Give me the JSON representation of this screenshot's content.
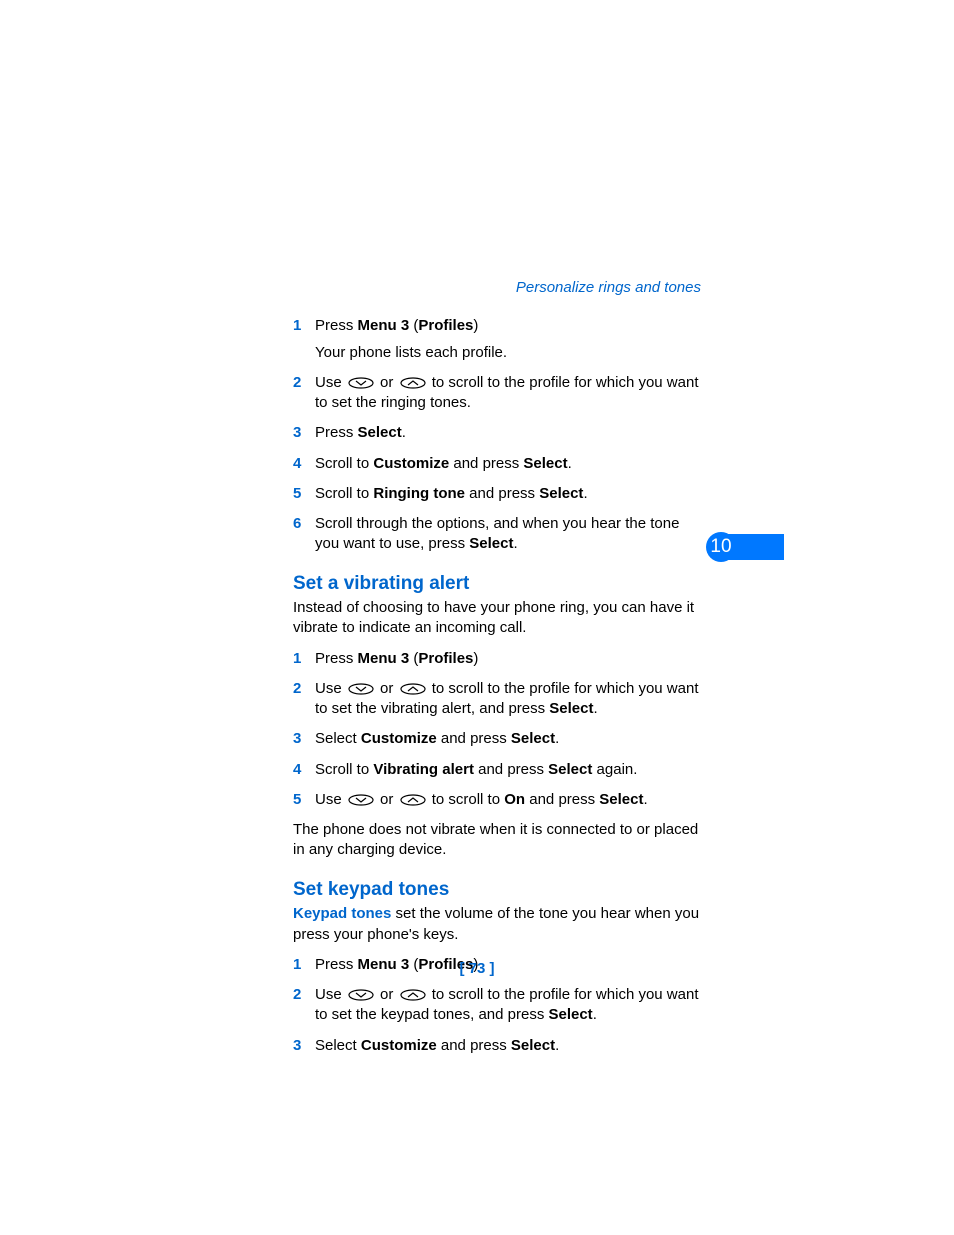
{
  "header": "Personalize rings and tones",
  "chapter_number": "10",
  "page_number": "[ 73 ]",
  "section_a": {
    "steps": [
      {
        "n": "1",
        "parts": [
          "Press ",
          {
            "b": "Menu 3"
          },
          " (",
          {
            "b": "Profiles"
          },
          ")"
        ],
        "after": "Your phone lists each profile."
      },
      {
        "n": "2",
        "parts": [
          "Use ",
          {
            "icon": "down"
          },
          " or ",
          {
            "icon": "up"
          },
          " to scroll to the profile for which you want to set the ringing tones."
        ]
      },
      {
        "n": "3",
        "parts": [
          "Press ",
          {
            "b": "Select"
          },
          "."
        ]
      },
      {
        "n": "4",
        "parts": [
          "Scroll to ",
          {
            "b": "Customize"
          },
          " and press ",
          {
            "b": "Select"
          },
          "."
        ]
      },
      {
        "n": "5",
        "parts": [
          "Scroll to ",
          {
            "b": "Ringing tone"
          },
          " and press ",
          {
            "b": "Select"
          },
          "."
        ]
      },
      {
        "n": "6",
        "parts": [
          "Scroll through the options, and when you hear the tone you want to use, press ",
          {
            "b": "Select"
          },
          "."
        ]
      }
    ]
  },
  "section_b": {
    "title": "Set a vibrating alert",
    "intro": "Instead of choosing to have your phone ring, you can have it vibrate to indicate an incoming call.",
    "steps": [
      {
        "n": "1",
        "parts": [
          "Press ",
          {
            "b": "Menu 3"
          },
          " (",
          {
            "b": "Profiles"
          },
          ")"
        ]
      },
      {
        "n": "2",
        "parts": [
          "Use ",
          {
            "icon": "down"
          },
          " or ",
          {
            "icon": "up"
          },
          " to scroll to the profile for which you want to set the vibrating alert, and press ",
          {
            "b": "Select"
          },
          "."
        ]
      },
      {
        "n": "3",
        "parts": [
          "Select ",
          {
            "b": "Customize"
          },
          " and press ",
          {
            "b": "Select"
          },
          "."
        ]
      },
      {
        "n": "4",
        "parts": [
          "Scroll to ",
          {
            "b": "Vibrating alert"
          },
          " and press ",
          {
            "b": "Select"
          },
          " again."
        ]
      },
      {
        "n": "5",
        "parts": [
          "Use ",
          {
            "icon": "down"
          },
          " or ",
          {
            "icon": "up"
          },
          " to scroll to ",
          {
            "b": "On"
          },
          " and press ",
          {
            "b": "Select"
          },
          "."
        ]
      }
    ],
    "note": "The phone does not vibrate when it is connected to or placed in any charging device."
  },
  "section_c": {
    "title": "Set keypad tones",
    "intro_parts": [
      {
        "bblue": "Keypad tones"
      },
      " set the volume of the tone you hear when you press your phone's keys."
    ],
    "steps": [
      {
        "n": "1",
        "parts": [
          "Press ",
          {
            "b": "Menu 3"
          },
          " (",
          {
            "b": "Profiles"
          },
          ")"
        ]
      },
      {
        "n": "2",
        "parts": [
          "Use ",
          {
            "icon": "down"
          },
          " or ",
          {
            "icon": "up"
          },
          " to scroll to the profile for which you want to set the keypad tones, and press ",
          {
            "b": "Select"
          },
          "."
        ]
      },
      {
        "n": "3",
        "parts": [
          "Select ",
          {
            "b": "Customize"
          },
          " and press ",
          {
            "b": "Select"
          },
          "."
        ]
      }
    ]
  }
}
